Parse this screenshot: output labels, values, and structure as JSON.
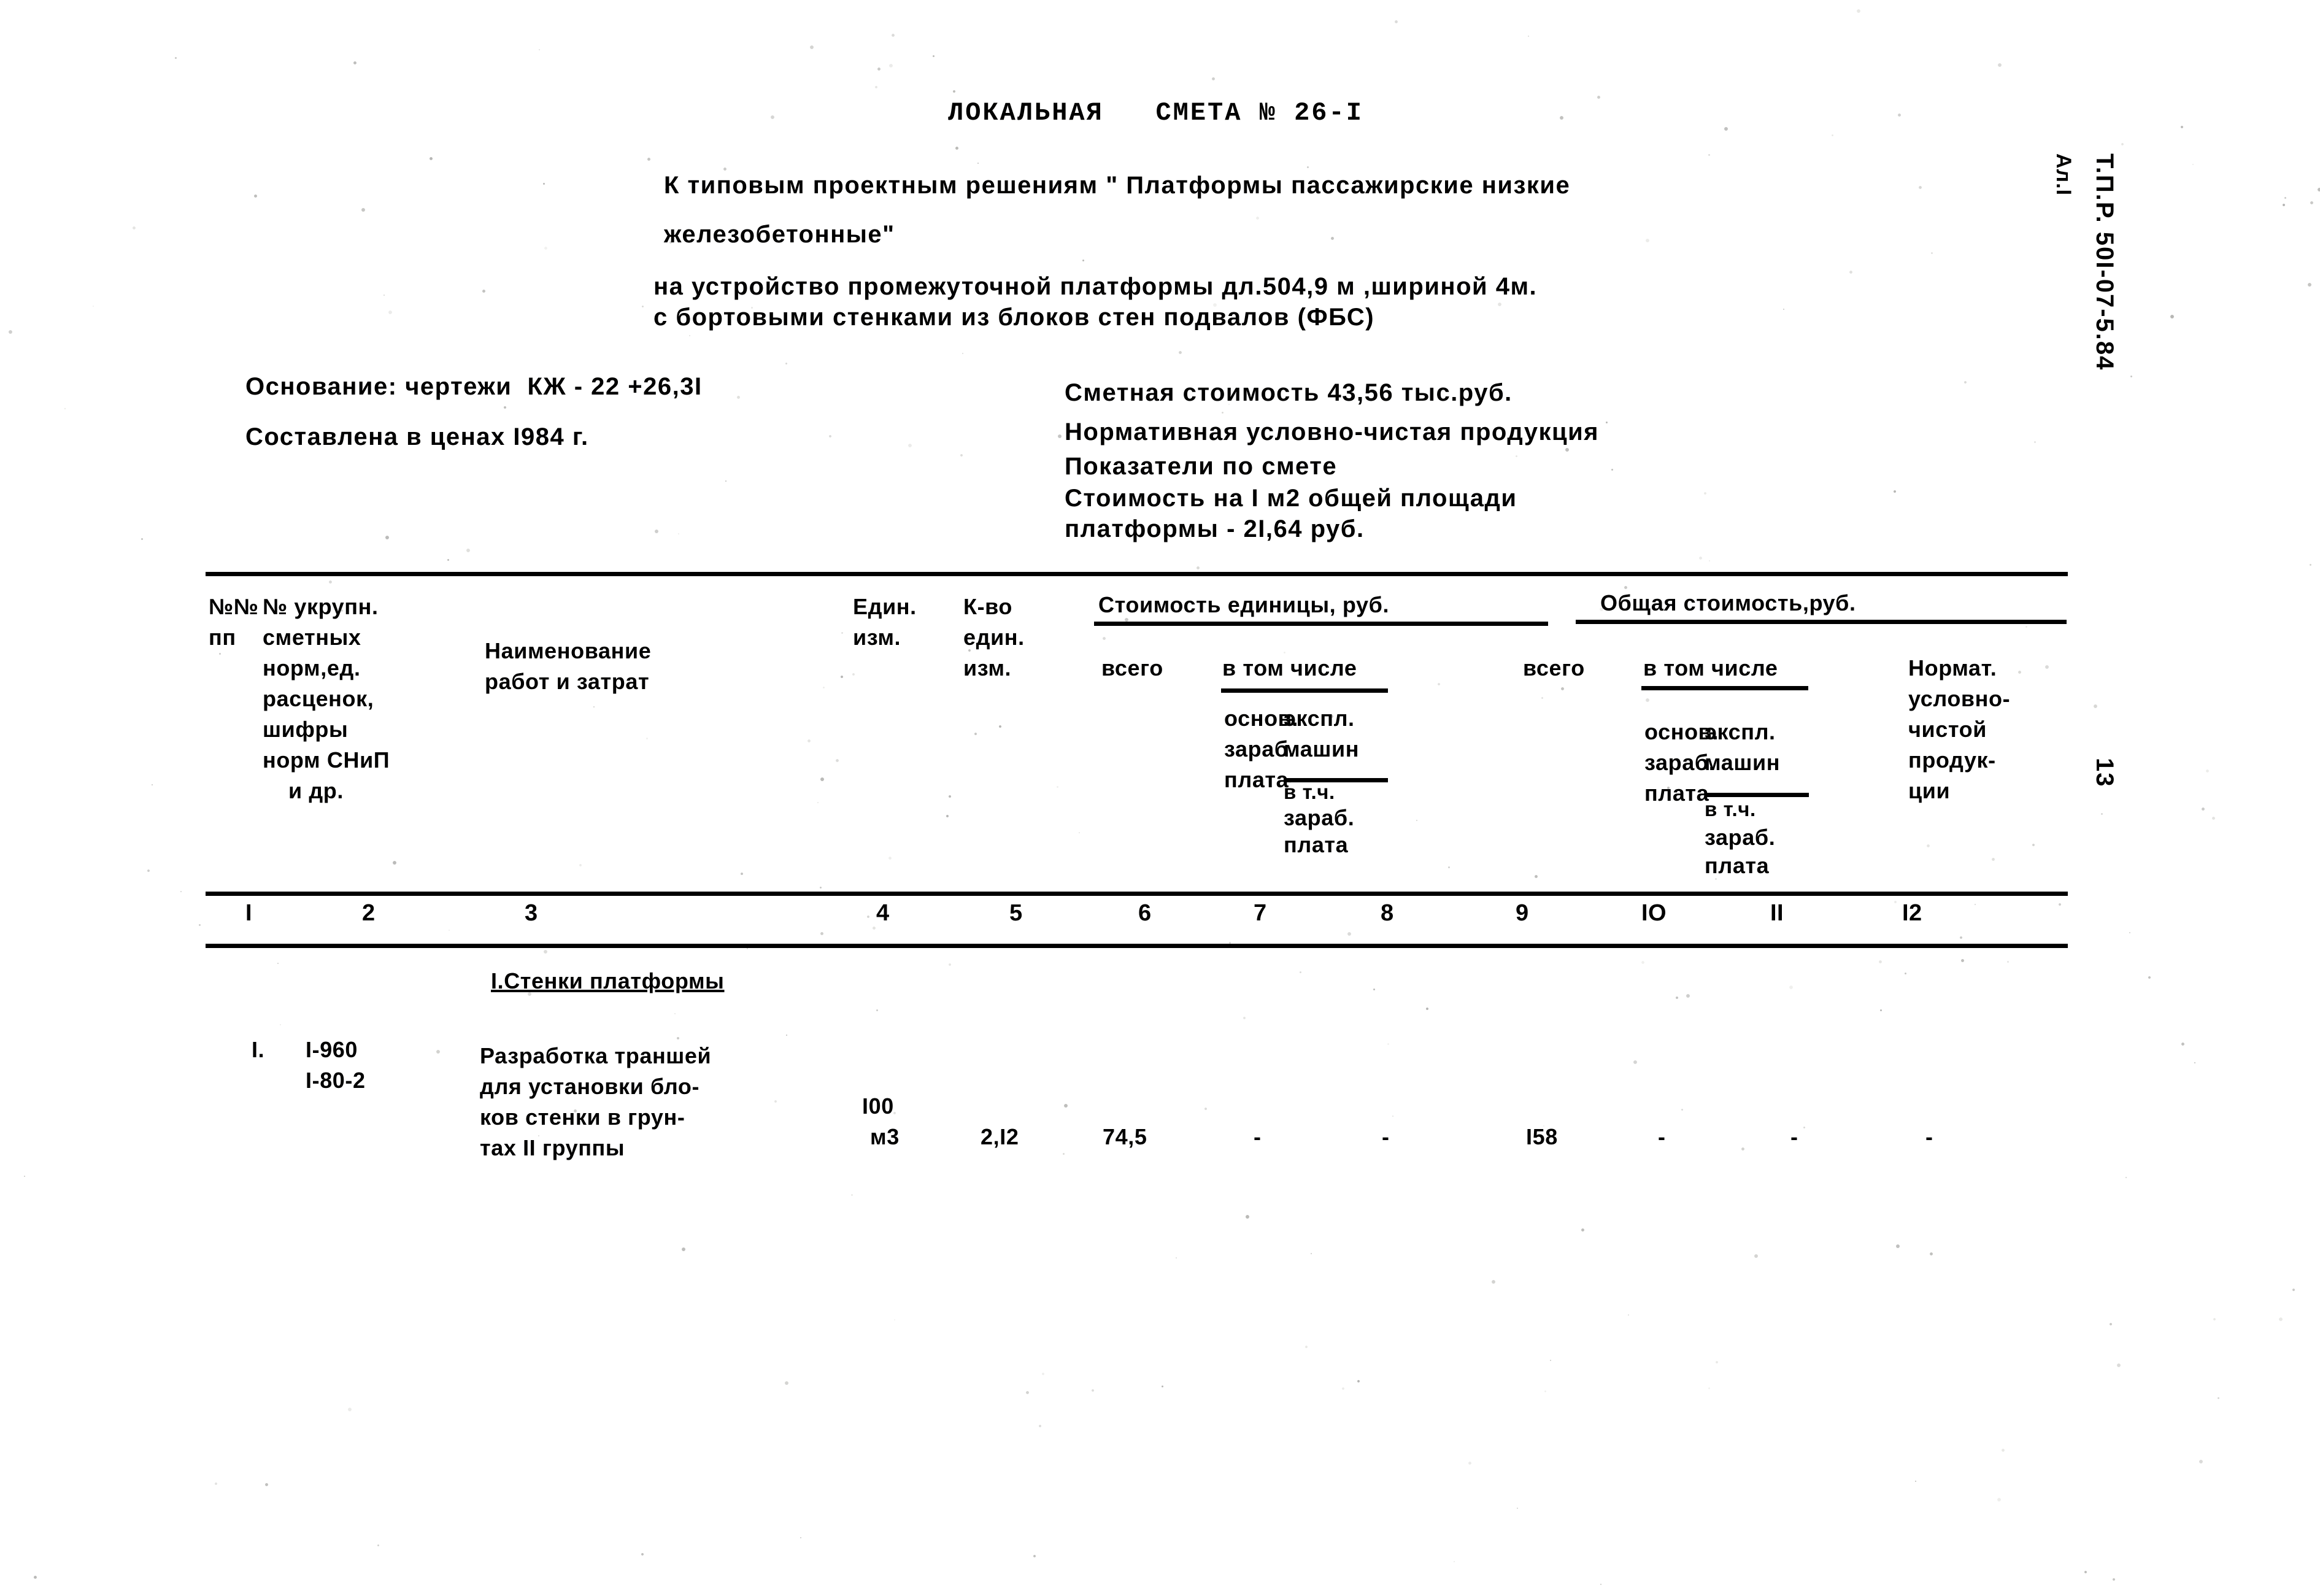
{
  "document": {
    "title": "ЛОКАЛЬНАЯ   СМЕТА № 26-I",
    "intro_line1": "К типовым проектным решениям \" Платформы пассажирские низкие",
    "intro_line2": "железобетонные\"",
    "intro_line3": "на устройство промежуточной платформы дл.504,9 м ,шириной 4м.",
    "intro_line4": "с бортовыми стенками из блоков стен подвалов (ФБС)"
  },
  "basis": {
    "line1": "Основание: чертежи  КЖ - 22 +26,3I",
    "line2": "Составлена в ценах I984 г."
  },
  "summary": {
    "line1": "Сметная стоимость 43,56 тыс.руб.",
    "line2": "Нормативная условно-чистая продукция",
    "line3": "Показатели по смете",
    "line4": "Стоимость на I м2 общей площади",
    "line5": "платформы - 2I,64 руб."
  },
  "margin": {
    "code_line1": "Т.П.Р. 50I-07-5.84",
    "code_line2": "Ал.I",
    "page_number": "13"
  },
  "table": {
    "headers": {
      "col1": [
        "№№",
        "пп"
      ],
      "col2": [
        "№ укрупн.",
        "сметных",
        "норм,ед.",
        "расценок,",
        "шифры",
        "норм СНиП",
        "и др."
      ],
      "col3": [
        "Наименование",
        "работ и затрат"
      ],
      "col4": [
        "Един.",
        "изм."
      ],
      "col5": [
        "К-во",
        "един.",
        "изм."
      ],
      "group_unit_cost": "Стоимость единицы, руб.",
      "group_total_cost": "Общая стоимость,руб.",
      "unit_total": "всего",
      "unit_among": "в том числе",
      "unit_basic_wage": [
        "основ.",
        "зараб.",
        "плата"
      ],
      "unit_machines": [
        "экспл.",
        "машин"
      ],
      "unit_machines_sub": [
        "в т.ч.",
        "зараб.",
        "плата"
      ],
      "total_total": "всего",
      "total_among": "в том числе",
      "total_basic_wage": [
        "основ.",
        "зараб.",
        "плата"
      ],
      "total_machines": [
        "экспл.",
        "машин"
      ],
      "total_machines_sub": [
        "в т.ч.",
        "зараб.",
        "плата"
      ],
      "col12": [
        "Нормат.",
        "условно-",
        "чистой",
        "продук-",
        "ции"
      ]
    },
    "column_numbers": [
      "I",
      "2",
      "3",
      "4",
      "5",
      "6",
      "7",
      "8",
      "9",
      "IO",
      "II",
      "I2"
    ],
    "section_title": "I.Стенки платформы",
    "rows": [
      {
        "no": "I.",
        "norm_code": [
          "I-960",
          "I-80-2"
        ],
        "name": [
          "Разработка траншей",
          "для установки бло-",
          "ков стенки в грун-",
          "тах II группы"
        ],
        "unit": [
          "I00",
          "м3"
        ],
        "qty": "2,I2",
        "unit_total": "74,5",
        "unit_basic_wage": "-",
        "unit_machines": "-",
        "total_total": "I58",
        "total_basic_wage": "-",
        "total_machines": "-",
        "nchp": "-"
      }
    ]
  }
}
